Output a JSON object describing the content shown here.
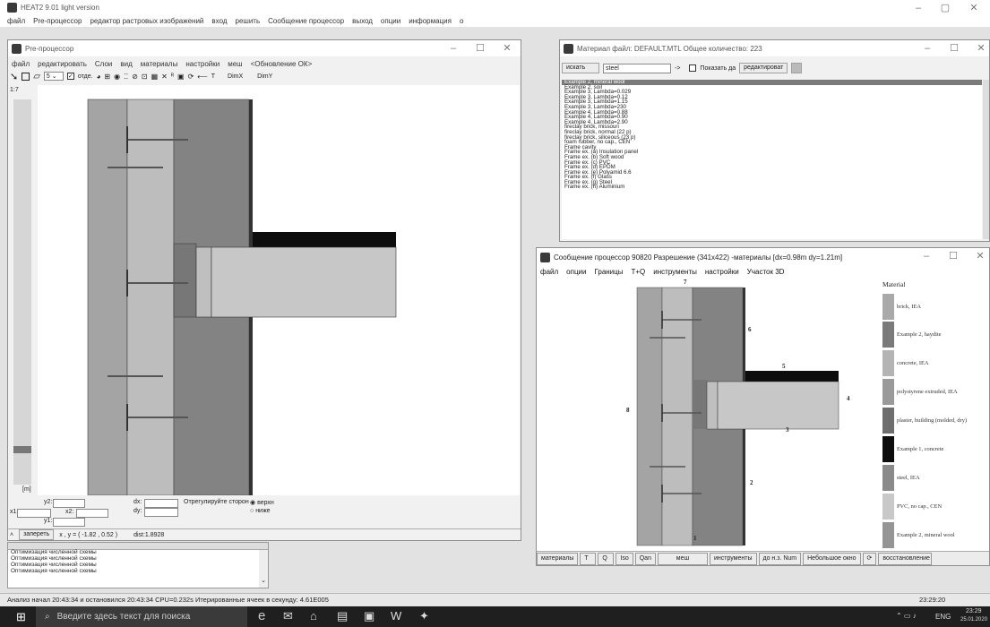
{
  "app": {
    "title": "HEAT2 9.01 light version",
    "menu": [
      "файл",
      "Pre-процессор",
      "редактор растровых изображений",
      "вход",
      "решить",
      "Сообщение процессор",
      "выход",
      "опции",
      "информация",
      "о"
    ]
  },
  "pre": {
    "title": "Pre-процессор",
    "menu": [
      "файл",
      "редактировать",
      "Слои",
      "вид",
      "материалы",
      "настройки",
      "меш",
      "<Обновление ОК>"
    ],
    "toolbar": {
      "num": "5",
      "grid_label": "отде.",
      "extra": "ᴿ",
      "arrow_t": "T",
      "dimx": "DimX",
      "dimy": "DimY"
    },
    "scale_label": "1:7",
    "unit_label": "[m]",
    "coords": {
      "y2": "y2:",
      "x1": "x1:",
      "x2": "x2:",
      "y1": "y1:",
      "dx": "dx:",
      "dy": "dy:",
      "adjust": "Отрегулируйте сторон",
      "upper": "верхн",
      "lower": "ниже"
    },
    "status": {
      "lock": "запереть",
      "xy": "x , y = ( -1.82 ,  0.52 )",
      "dist": "dist:1.8928"
    }
  },
  "log": {
    "lines": [
      "Оптимизация численной схемы",
      "Оптимизация численной схемы",
      "Оптимизация численной схемы",
      "Оптимизация численной схемы"
    ]
  },
  "material": {
    "title": "Материал файл: DEFAULT.MTL  Общее количество: 223",
    "search_btn": "искать",
    "search_value": "steel",
    "arrow": "->",
    "show_label": "Показать да",
    "edit_btn": "редактироват",
    "items": [
      "Example 2, mineral wool",
      "Example 2, soil",
      "Example 3, Lambda=0.029",
      "Example 3, Lambda=0.12",
      "Example 3, Lambda=1.15",
      "Example 3, Lambda=230",
      "Example 4, Lambda=0.88",
      "Example 4, Lambda=0.90",
      "Example 4, Lambda=2.90",
      "fireclay brick, missouri",
      "fireclay brick, normal (22 p)",
      "fireclay brick, siliceous (23 p)",
      "foam rubber, no cap., CEN",
      "Frame cavity",
      "Frame ex. (a) Insulation panel",
      "Frame ex. (b) Soft wood",
      "Frame ex. (c) PVC",
      "Frame ex. (d) EPDM",
      "Frame ex. (e) Polyamid 6.6",
      "Frame ex. (f) Glass",
      "Frame ex. (g) Steel",
      "Frame ex. (h) Aluminium"
    ]
  },
  "msg": {
    "title": "Сообщение процессор 90820 Разрешение (341x422) -материалы  [dx=0.98m  dy=1.21m]",
    "menu": [
      "файл",
      "опции",
      "Границы",
      "T+Q",
      "инструменты",
      "настройки",
      "Участок 3D"
    ],
    "legend_title": "Material",
    "legend": [
      {
        "label": "brick, IEA",
        "color": "#a9a9a9"
      },
      {
        "label": "Example 2, haydite",
        "color": "#7a7a7a"
      },
      {
        "label": "concrete, IEA",
        "color": "#b4b4b4"
      },
      {
        "label": "polystyrene extruded, IEA",
        "color": "#9a9a9a"
      },
      {
        "label": "plaster, building (molded, dry)",
        "color": "#6e6e6e"
      },
      {
        "label": "Example 1, concrete",
        "color": "#0d0d0d"
      },
      {
        "label": "steel, IEA",
        "color": "#8a8a8a"
      },
      {
        "label": "PVC, no cap., CEN",
        "color": "#c8c8c8"
      },
      {
        "label": "Example 2, mineral wool",
        "color": "#959595"
      }
    ],
    "boundary_numbers": [
      "7",
      "6",
      "5",
      "4",
      "3",
      "8",
      "2",
      "1"
    ],
    "buttons": [
      "материалы",
      "T",
      "Q",
      "Iso",
      "Qan",
      "меш",
      "инструменты",
      "до н.з. Num",
      "Небольшое окно",
      "восстановление"
    ]
  },
  "statusbar": {
    "text": "Анализ начал 20:43:34 и остановился 20:43:34   CPU=0.232s   Итерированные ячеек в секунду: 4.61E005",
    "time": "23:29:20"
  },
  "taskbar": {
    "search": "Введите здесь текст для поиска",
    "lang": "ENG",
    "clock": "23:29",
    "date": "25.01.2020"
  }
}
